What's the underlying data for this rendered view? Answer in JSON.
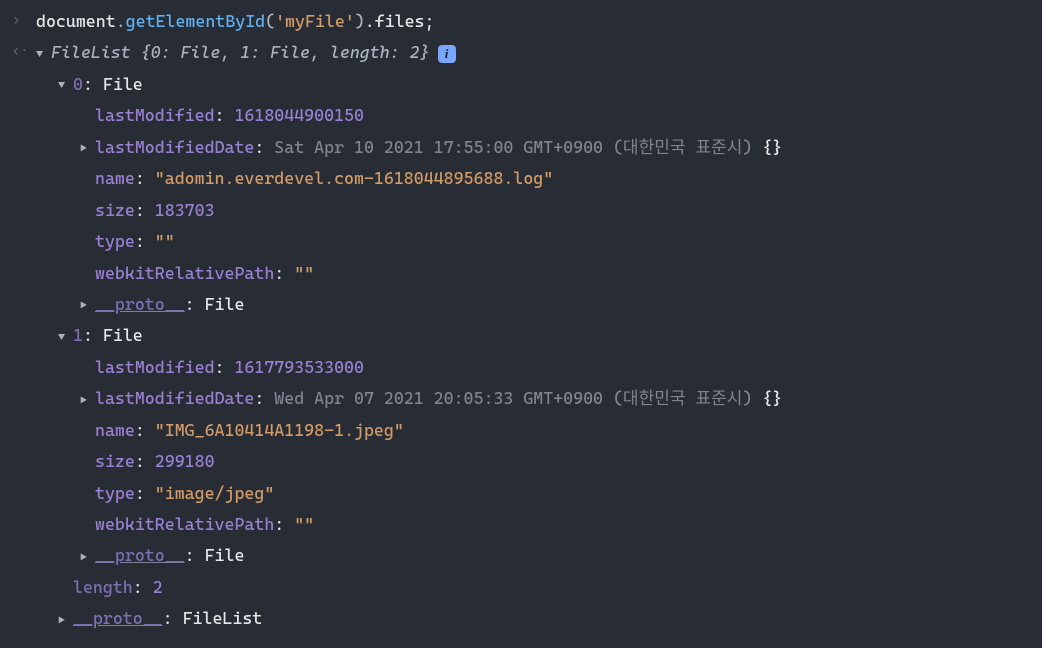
{
  "input": {
    "obj": "document",
    "method": "getElementById",
    "arg": "'myFile'",
    "tail": ".files;"
  },
  "summary": {
    "type": "FileList",
    "preview": "{0: File, 1: File, length: 2}"
  },
  "files": [
    {
      "index": "0",
      "typeName": "File",
      "lastModified": "1618044900150",
      "lastModifiedDate": "Sat Apr 10 2021 17:55:00 GMT+0900 (대한민국 표준시)",
      "name": "\"adomin.everdevel.com-1618044895688.log\"",
      "size": "183703",
      "type": "\"\"",
      "webkitRelativePath": "\"\"",
      "proto": "File"
    },
    {
      "index": "1",
      "typeName": "File",
      "lastModified": "1617793533000",
      "lastModifiedDate": "Wed Apr 07 2021 20:05:33 GMT+0900 (대한민국 표준시)",
      "name": "\"IMG_6A10414A1198-1.jpeg\"",
      "size": "299180",
      "type": "\"image/jpeg\"",
      "webkitRelativePath": "\"\"",
      "proto": "File"
    }
  ],
  "length": {
    "key": "length",
    "value": "2"
  },
  "outerProto": {
    "key": "__proto__",
    "value": "FileList"
  },
  "labels": {
    "lastModified": "lastModified",
    "lastModifiedDate": "lastModifiedDate",
    "name": "name",
    "size": "size",
    "type": "type",
    "webkitRelativePath": "webkitRelativePath",
    "proto": "__proto__"
  },
  "glyphs": {
    "prompt": "›",
    "result": "‹·",
    "down": "▼",
    "right": "▶",
    "info": "i",
    "braces": "{}"
  }
}
